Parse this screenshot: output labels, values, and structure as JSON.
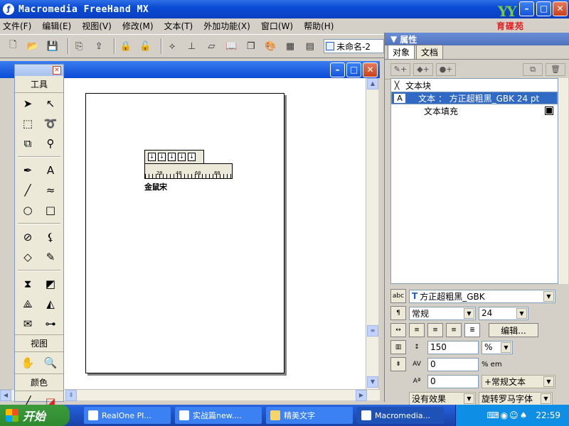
{
  "app": {
    "title": "Macromedia FreeHand MX",
    "logo_text": "育碟苑",
    "logo_mark": "YY"
  },
  "menubar": [
    "文件(F)",
    "编辑(E)",
    "视图(V)",
    "修改(M)",
    "文本(T)",
    "外加功能(X)",
    "窗口(W)",
    "帮助(H)"
  ],
  "toolbar": {
    "document_name": "未命名-2"
  },
  "tools": {
    "title": "工具",
    "view_label": "视图",
    "color_label": "颜色"
  },
  "canvas": {
    "ruler_ticks": [
      "20",
      "40",
      "60",
      "80"
    ],
    "text": "金鼠宋"
  },
  "properties": {
    "title": "属性",
    "tabs": [
      "对象",
      "文档"
    ],
    "tree": [
      {
        "label": "文本块"
      },
      {
        "label": "文本 ： 方正超粗黑_GBK 24 pt"
      },
      {
        "label": "文本填充"
      }
    ],
    "font_name": "方正超粗黑_GBK",
    "font_style": "常规",
    "font_size": "24",
    "edit_button": "编辑...",
    "leading": "150",
    "leading_unit": "%",
    "tracking": "0",
    "tracking_unit": "% em",
    "baseline": "0",
    "text_style": "+常规文本",
    "effect": "没有效果",
    "rotate": "旋转罗马字体"
  },
  "taskbar": {
    "start": "开始",
    "tasks": [
      "RealOne Pl...",
      "实战篇new....",
      "精美文字",
      "Macromedia..."
    ],
    "clock": "22:59"
  }
}
